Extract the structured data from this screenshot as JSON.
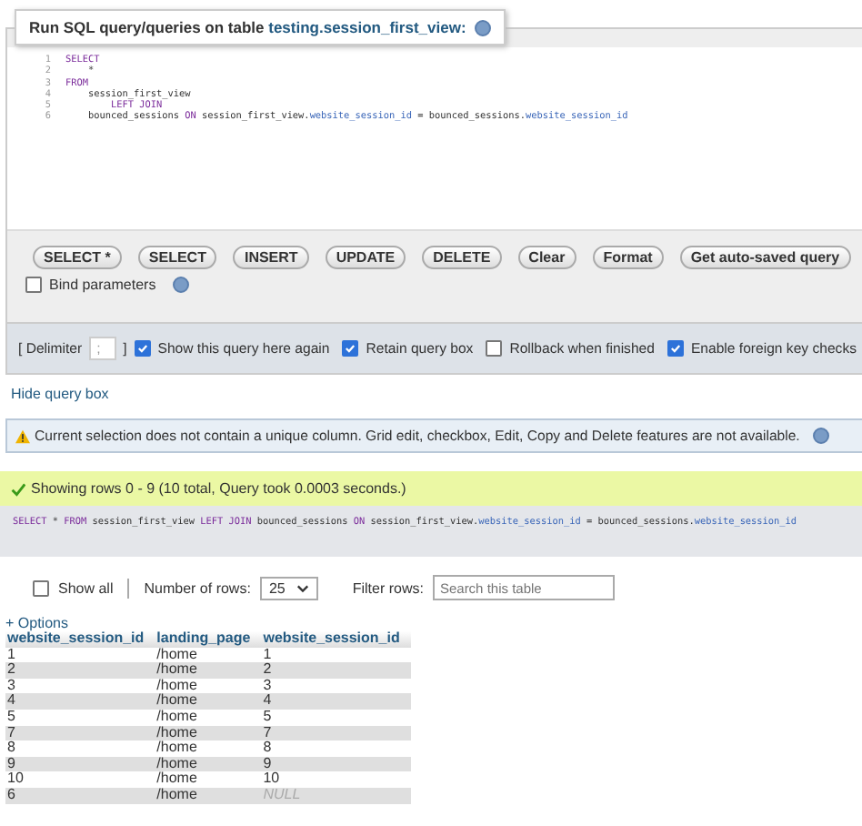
{
  "legend": {
    "text": "Run SQL query/queries on table ",
    "table_link": "testing.session_first_view:"
  },
  "editor": {
    "lines": [
      {
        "number": "1",
        "segments": [
          {
            "text": "SELECT",
            "kind": "keyword"
          }
        ]
      },
      {
        "number": "2",
        "segments": [
          {
            "text": "    *",
            "kind": "plain"
          }
        ]
      },
      {
        "number": "3",
        "segments": [
          {
            "text": "FROM",
            "kind": "keyword"
          }
        ]
      },
      {
        "number": "4",
        "segments": [
          {
            "text": "    session_first_view",
            "kind": "plain"
          }
        ]
      },
      {
        "number": "5",
        "segments": [
          {
            "text": "        LEFT JOIN",
            "kind": "keyword"
          }
        ]
      },
      {
        "number": "6",
        "segments": [
          {
            "text": "    bounced_sessions ",
            "kind": "plain"
          },
          {
            "text": "ON",
            "kind": "keyword"
          },
          {
            "text": " session_first_view.",
            "kind": "plain"
          },
          {
            "text": "website_session_id",
            "kind": "field"
          },
          {
            "text": " = ",
            "kind": "plain"
          },
          {
            "text": "bounced_sessions.",
            "kind": "plain"
          },
          {
            "text": "website_session_id",
            "kind": "field"
          }
        ]
      }
    ]
  },
  "buttons": [
    "SELECT *",
    "SELECT",
    "INSERT",
    "UPDATE",
    "DELETE",
    "Clear",
    "Format",
    "Get auto-saved query"
  ],
  "bind_parameters": {
    "label": "Bind parameters",
    "checked": false
  },
  "options": {
    "delimiter_label": "[ Delimiter",
    "delimiter_value": ";",
    "delimiter_close": "]",
    "checkboxes": [
      {
        "label": "Show this query here again",
        "checked": true
      },
      {
        "label": "Retain query box",
        "checked": true
      },
      {
        "label": "Rollback when finished",
        "checked": false
      },
      {
        "label": "Enable foreign key checks",
        "checked": true
      }
    ]
  },
  "hide_query_box": "Hide query box",
  "warning": "Current selection does not contain a unique column. Grid edit, checkbox, Edit, Copy and Delete features are not available.",
  "success": "Showing rows 0 - 9 (10 total, Query took 0.0003 seconds.)",
  "executed_sql": [
    {
      "text": "SELECT",
      "kind": "keyword"
    },
    {
      "text": " * ",
      "kind": "plain"
    },
    {
      "text": "FROM",
      "kind": "keyword"
    },
    {
      "text": " session_first_view ",
      "kind": "plain"
    },
    {
      "text": "LEFT JOIN",
      "kind": "keyword"
    },
    {
      "text": " bounced_sessions ",
      "kind": "plain"
    },
    {
      "text": "ON",
      "kind": "keyword"
    },
    {
      "text": " session_first_view.",
      "kind": "plain"
    },
    {
      "text": "website_session_id",
      "kind": "field"
    },
    {
      "text": " = bounced_sessions.",
      "kind": "plain"
    },
    {
      "text": "website_session_id",
      "kind": "field"
    }
  ],
  "controls": {
    "show_all": {
      "label": "Show all",
      "checked": false
    },
    "rows_label": "Number of rows:",
    "rows_value": "25",
    "filter_label": "Filter rows:",
    "filter_placeholder": "Search this table"
  },
  "options_link": "+ Options",
  "table": {
    "columns": [
      "website_session_id",
      "landing_page",
      "website_session_id"
    ],
    "rows": [
      {
        "cells": [
          "1",
          "/home",
          "1"
        ],
        "null_last": false
      },
      {
        "cells": [
          "2",
          "/home",
          "2"
        ],
        "null_last": false
      },
      {
        "cells": [
          "3",
          "/home",
          "3"
        ],
        "null_last": false
      },
      {
        "cells": [
          "4",
          "/home",
          "4"
        ],
        "null_last": false
      },
      {
        "cells": [
          "5",
          "/home",
          "5"
        ],
        "null_last": false
      },
      {
        "cells": [
          "7",
          "/home",
          "7"
        ],
        "null_last": false
      },
      {
        "cells": [
          "8",
          "/home",
          "8"
        ],
        "null_last": false
      },
      {
        "cells": [
          "9",
          "/home",
          "9"
        ],
        "null_last": false
      },
      {
        "cells": [
          "10",
          "/home",
          "10"
        ],
        "null_last": false
      },
      {
        "cells": [
          "6",
          "/home",
          "NULL"
        ],
        "null_last": true
      }
    ]
  }
}
